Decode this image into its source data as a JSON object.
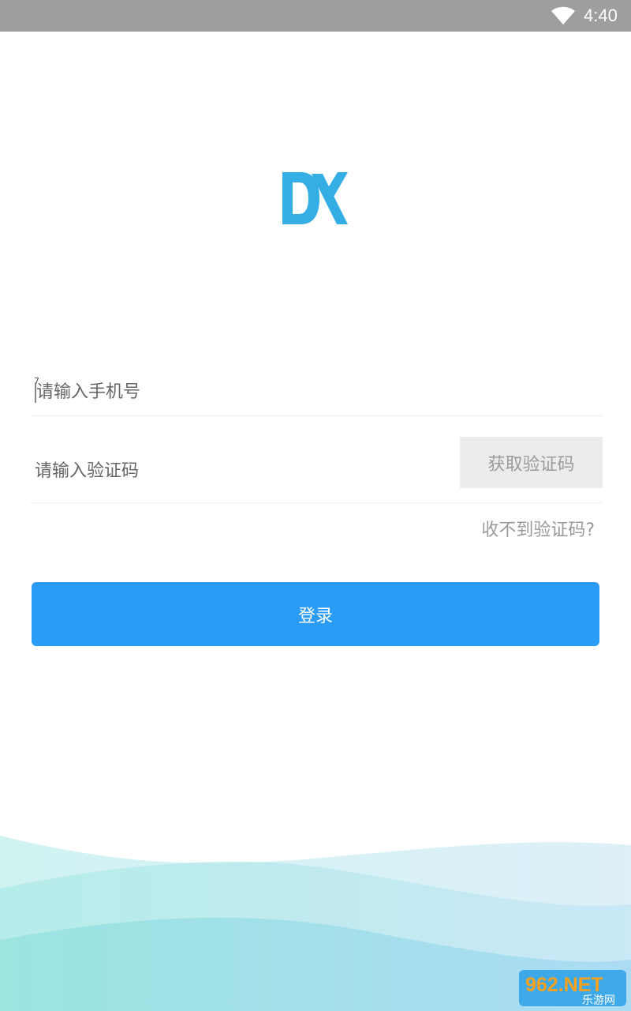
{
  "status_bar": {
    "time": "4:40",
    "wifi_icon": "wifi-icon",
    "background_color": "#9e9e9e"
  },
  "logo": {
    "icon": "dx-logo-icon",
    "color": "#35aee6"
  },
  "login_form": {
    "phone_placeholder": "请输入手机号",
    "code_placeholder": "请输入验证码",
    "get_code_label": "获取验证码",
    "no_code_label": "收不到验证码?",
    "login_label": "登录",
    "accent_color": "#2a9cf8"
  },
  "watermark": {
    "brand": "962.NET",
    "subtitle": "乐游网"
  }
}
